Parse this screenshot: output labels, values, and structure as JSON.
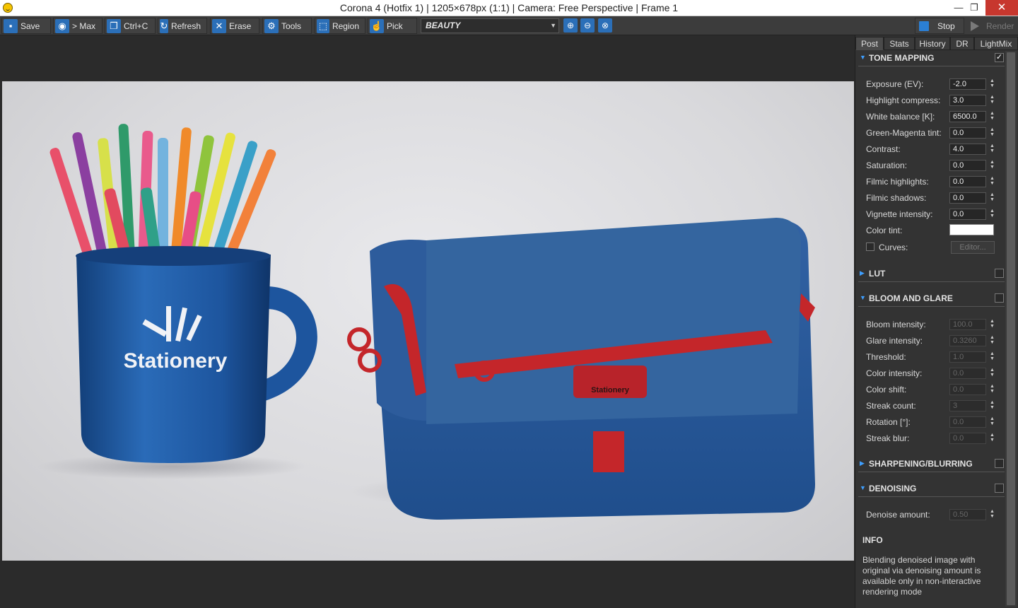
{
  "window": {
    "title": "Corona 4 (Hotfix 1) | 1205×678px (1:1) | Camera: Free Perspective | Frame 1",
    "minimize": "—",
    "maximize": "❐",
    "close": "✕"
  },
  "toolbar": {
    "save": "Save",
    "max": "> Max",
    "copy": "Ctrl+C",
    "refresh": "Refresh",
    "erase": "Erase",
    "tools": "Tools",
    "region": "Region",
    "pick": "Pick",
    "render_element": "BEAUTY",
    "stop": "Stop",
    "render": "Render"
  },
  "render_image": {
    "mug_logo_text": "Stationery",
    "tag_text": "Stationery"
  },
  "panel": {
    "tabs": [
      "Post",
      "Stats",
      "History",
      "DR",
      "LightMix"
    ],
    "active_tab": "Post",
    "tone_mapping": {
      "title": "TONE MAPPING",
      "enabled": true,
      "props": [
        {
          "label": "Exposure (EV):",
          "value": "-2.0"
        },
        {
          "label": "Highlight compress:",
          "value": "3.0"
        },
        {
          "label": "White balance [K]:",
          "value": "6500.0"
        },
        {
          "label": "Green-Magenta tint:",
          "value": "0.0"
        },
        {
          "label": "Contrast:",
          "value": "4.0"
        },
        {
          "label": "Saturation:",
          "value": "0.0"
        },
        {
          "label": "Filmic highlights:",
          "value": "0.0"
        },
        {
          "label": "Filmic shadows:",
          "value": "0.0"
        },
        {
          "label": "Vignette intensity:",
          "value": "0.0"
        }
      ],
      "color_tint_label": "Color tint:",
      "color_tint": "#ffffff",
      "curves_label": "Curves:",
      "editor_button": "Editor..."
    },
    "lut": {
      "title": "LUT",
      "enabled": false
    },
    "bloom": {
      "title": "BLOOM AND GLARE",
      "enabled": false,
      "props": [
        {
          "label": "Bloom intensity:",
          "value": "100.0"
        },
        {
          "label": "Glare intensity:",
          "value": "0.3260"
        },
        {
          "label": "Threshold:",
          "value": "1.0"
        },
        {
          "label": "Color intensity:",
          "value": "0.0"
        },
        {
          "label": "Color shift:",
          "value": "0.0"
        },
        {
          "label": "Streak count:",
          "value": "3"
        },
        {
          "label": "Rotation [°]:",
          "value": "0.0"
        },
        {
          "label": "Streak blur:",
          "value": "0.0"
        }
      ]
    },
    "sharpening": {
      "title": "SHARPENING/BLURRING",
      "enabled": false
    },
    "denoising": {
      "title": "DENOISING",
      "enabled": false,
      "amount_label": "Denoise amount:",
      "amount": "0.50"
    },
    "info": {
      "title": "INFO",
      "text": "Blending denoised image with original via denoising amount is available only in non-interactive rendering mode"
    }
  },
  "colors": {
    "accent": "#2b6fb8",
    "mug_blue": "#1f5aa0",
    "bag_blue": "#2a5a98",
    "bag_red": "#c4262a"
  }
}
